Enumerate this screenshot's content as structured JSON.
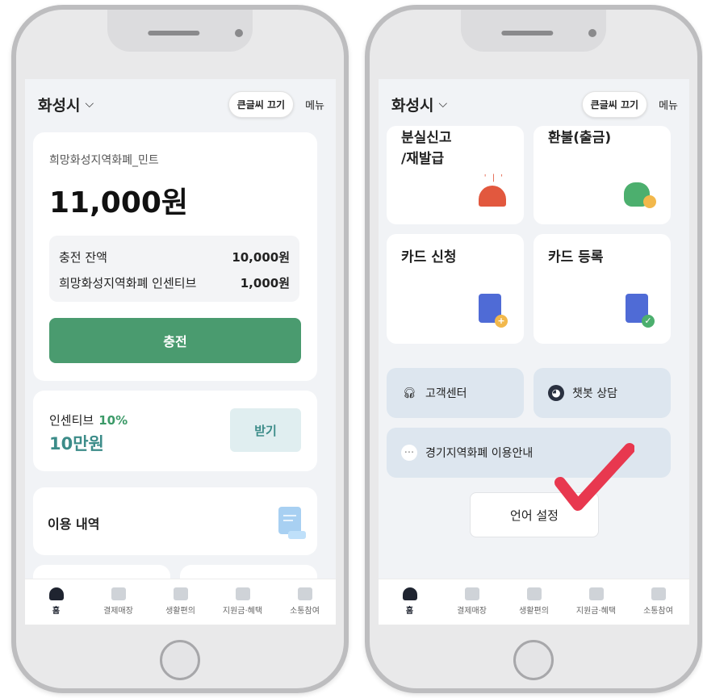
{
  "left_phone": {
    "topbar": {
      "city": "화성시",
      "big_font_button": "큰글씨 끄기",
      "menu": "메뉴"
    },
    "wallet": {
      "name": "희망화성지역화폐_민트",
      "amount": "11,000원",
      "rows": [
        {
          "label": "충전 잔액",
          "value": "10,000원"
        },
        {
          "label": "희망화성지역화폐 인센티브",
          "value": "1,000원"
        }
      ],
      "charge_button": "충전"
    },
    "incentive": {
      "label": "인센티브",
      "percent": "10%",
      "amount": "10만원",
      "button": "받기"
    },
    "usage": {
      "title": "이용 내역"
    }
  },
  "right_phone": {
    "topbar": {
      "city": "화성시",
      "big_font_button": "큰글씨 끄기",
      "menu": "메뉴"
    },
    "services": {
      "lost_card": "분실신고\n/재발급",
      "refund": "환불(출금)",
      "card_apply": "카드 신청",
      "card_register": "카드 등록"
    },
    "customer_center": "고객센터",
    "chatbot": "챗봇 상담",
    "guide": "경기지역화폐 이용안내",
    "language_button": "언어 설정"
  },
  "tabs": [
    {
      "label": "홈"
    },
    {
      "label": "결제매장"
    },
    {
      "label": "생활편의"
    },
    {
      "label": "지원금·혜택"
    },
    {
      "label": "소통참여"
    }
  ],
  "colors": {
    "primary_green": "#4a9b6f",
    "teal": "#3c8c89",
    "check_red": "#e8384f"
  }
}
